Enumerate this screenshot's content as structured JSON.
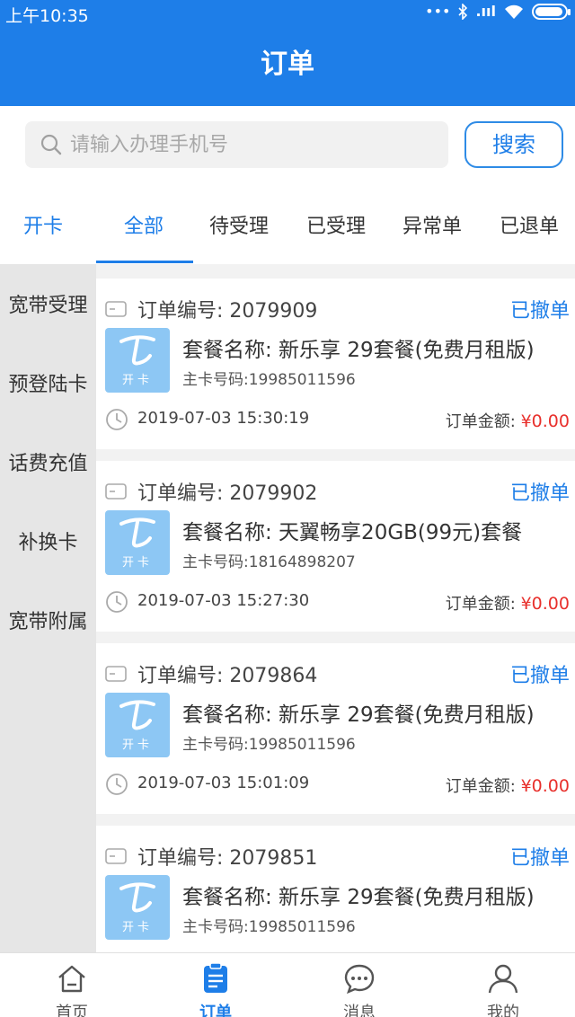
{
  "status_bar": {
    "time": "上午10:35",
    "dots": "•••",
    "signal": ".ııl"
  },
  "header": {
    "title": "订单"
  },
  "search": {
    "placeholder": "请输入办理手机号",
    "value": "",
    "button_label": "搜索"
  },
  "category_tab": {
    "label": "开卡"
  },
  "tabs": [
    {
      "label": "全部",
      "active": true
    },
    {
      "label": "待受理"
    },
    {
      "label": "已受理"
    },
    {
      "label": "异常单"
    },
    {
      "label": "已退单"
    }
  ],
  "sidebar": {
    "items": [
      {
        "label": "宽带受理"
      },
      {
        "label": "预登陆卡"
      },
      {
        "label": "话费充值"
      },
      {
        "label": "补换卡"
      },
      {
        "label": "宽带附属"
      }
    ]
  },
  "orders": [
    {
      "order_no": "订单编号: 2079909",
      "status": "已撤单",
      "logo_text": "开卡",
      "package": "套餐名称: 新乐享 29套餐(免费月租版)",
      "phone": "主卡号码:19985011596",
      "datetime": "2019-07-03 15:30:19",
      "amount_label": "订单金额: ",
      "amount": "¥0.00"
    },
    {
      "order_no": "订单编号: 2079902",
      "status": "已撤单",
      "logo_text": "开卡",
      "package": "套餐名称: 天翼畅享20GB(99元)套餐",
      "phone": "主卡号码:18164898207",
      "datetime": "2019-07-03 15:27:30",
      "amount_label": "订单金额: ",
      "amount": "¥0.00"
    },
    {
      "order_no": "订单编号: 2079864",
      "status": "已撤单",
      "logo_text": "开卡",
      "package": "套餐名称: 新乐享 29套餐(免费月租版)",
      "phone": "主卡号码:19985011596",
      "datetime": "2019-07-03 15:01:09",
      "amount_label": "订单金额: ",
      "amount": "¥0.00"
    },
    {
      "order_no": "订单编号: 2079851",
      "status": "已撤单",
      "logo_text": "开卡",
      "package": "套餐名称: 新乐享 29套餐(免费月租版)",
      "phone": "主卡号码:19985011596",
      "datetime": "",
      "amount_label": "",
      "amount": ""
    }
  ],
  "bottom_nav": [
    {
      "label": "首页",
      "icon": "home-icon"
    },
    {
      "label": "订单",
      "icon": "order-icon",
      "active": true
    },
    {
      "label": "消息",
      "icon": "message-icon"
    },
    {
      "label": "我的",
      "icon": "profile-icon"
    }
  ],
  "colors": {
    "primary": "#1e7ee8",
    "amount": "#e8302c",
    "logo_bg": "#8dc7f4"
  }
}
